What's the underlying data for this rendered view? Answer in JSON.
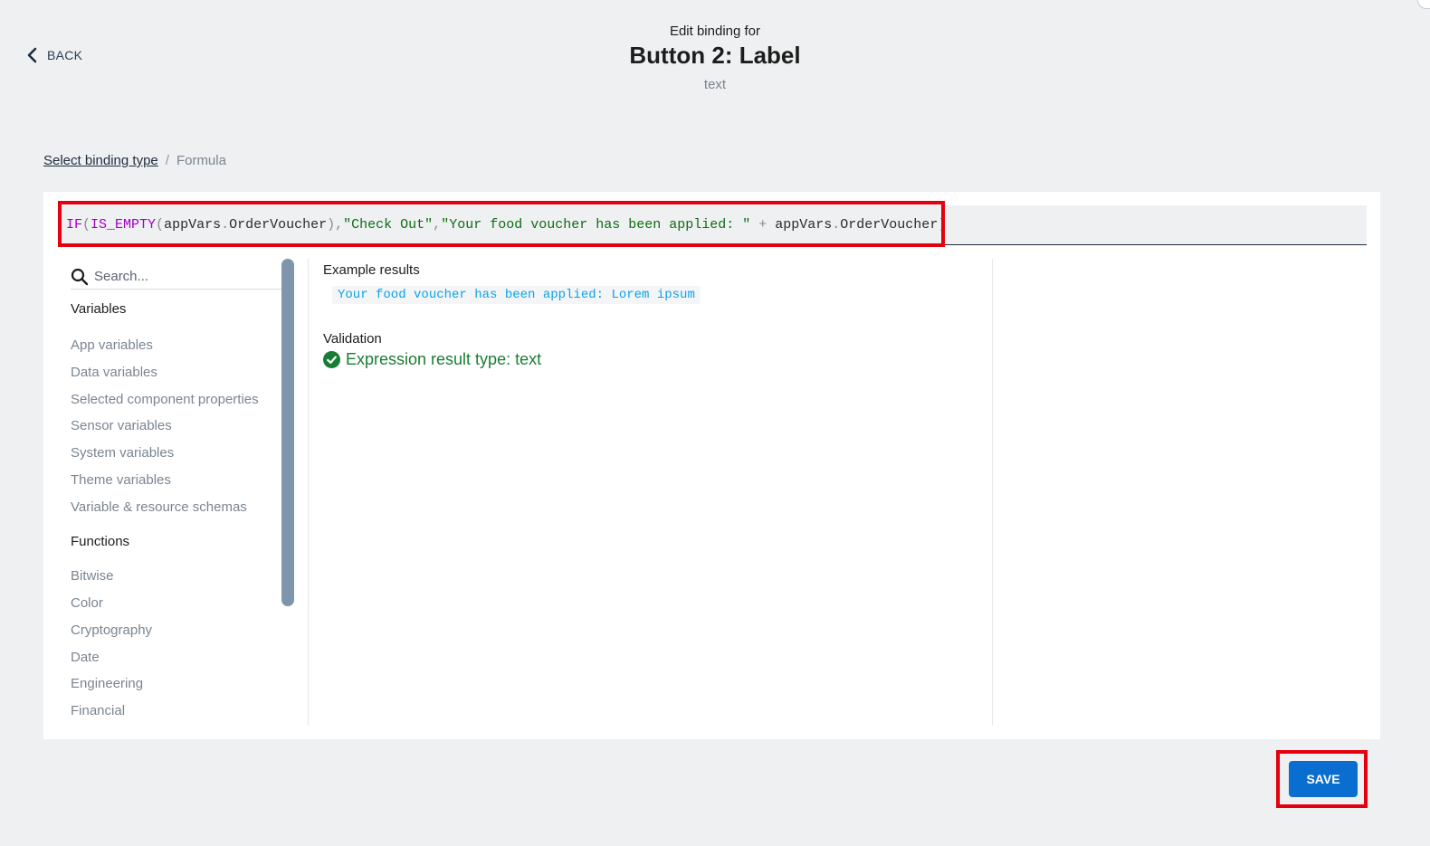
{
  "nav": {
    "back_label": "BACK"
  },
  "header": {
    "pre_title": "Edit binding for",
    "title": "Button 2: Label",
    "type": "text"
  },
  "breadcrumb": {
    "link": "Select binding type",
    "separator": "/",
    "current": "Formula"
  },
  "formula": {
    "tokens": {
      "t1": "IF",
      "t2": "(",
      "t3": "IS_EMPTY",
      "t4": "(",
      "t5": "appVars",
      "t6": ".",
      "t7": "OrderVoucher",
      "t8": "),",
      "t9": "\"Check Out\"",
      "t10": ",",
      "t11": "\"Your food voucher has been applied: \"",
      "t12": " + ",
      "t13": "appVars",
      "t14": ".",
      "t15": "OrderVoucher",
      "t16": ")"
    }
  },
  "sidebar": {
    "search_placeholder": "Search...",
    "variables_title": "Variables",
    "variables": [
      "App variables",
      "Data variables",
      "Selected component properties",
      "Sensor variables",
      "System variables",
      "Theme variables",
      "Variable & resource schemas"
    ],
    "functions_title": "Functions",
    "functions": [
      "Bitwise",
      "Color",
      "Cryptography",
      "Date",
      "Engineering",
      "Financial"
    ]
  },
  "results": {
    "example_label": "Example results",
    "example_value": "Your food voucher has been applied: Lorem ipsum",
    "validation_label": "Validation",
    "validation_message": "Expression result type: text"
  },
  "footer": {
    "save_label": "SAVE"
  },
  "colors": {
    "accent": "#0a6ed1",
    "highlight": "#e3000f",
    "success": "#1a7d35",
    "function_token": "#a100c2",
    "string_token": "#0f6e10"
  }
}
